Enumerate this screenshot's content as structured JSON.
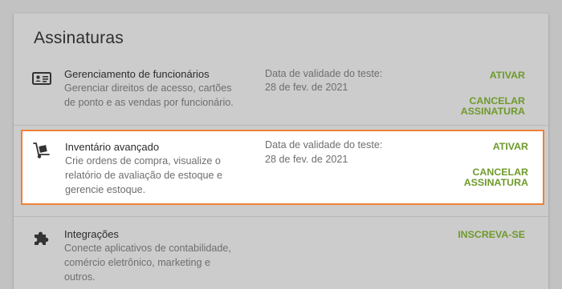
{
  "page": {
    "title": "Assinaturas"
  },
  "subscriptions": [
    {
      "name": "Gerenciamento de funcionários",
      "desc_lines": [
        "Gerenciar direitos de acesso, cartões",
        "de ponto e as vendas por funcionário."
      ],
      "trial_label": "Data de validade do teste:",
      "trial_date": "28 de fev. de 2021",
      "activate_label": "ATIVAR",
      "cancel_line1": "CANCELAR",
      "cancel_line2": "ASSINATURA",
      "icon": "id-card-icon"
    },
    {
      "name": "Inventário avançado",
      "desc_lines": [
        "Crie ordens de compra, visualize o",
        "relatório de avaliação de estoque e",
        "gerencie estoque."
      ],
      "trial_label": "Data de validade do teste:",
      "trial_date": "28 de fev. de 2021",
      "activate_label": "ATIVAR",
      "cancel_line1": "CANCELAR",
      "cancel_line2": "ASSINATURA",
      "icon": "hand-truck-icon"
    },
    {
      "name": "Integrações",
      "desc_lines": [
        "Conecte aplicativos de contabilidade,",
        "comércio eletrônico, marketing e",
        "outros."
      ],
      "subscribe_label": "INSCREVA-SE",
      "icon": "puzzle-piece-icon"
    }
  ],
  "colors": {
    "accent": "#6f9a2b",
    "highlight_border": "#ee8136"
  }
}
